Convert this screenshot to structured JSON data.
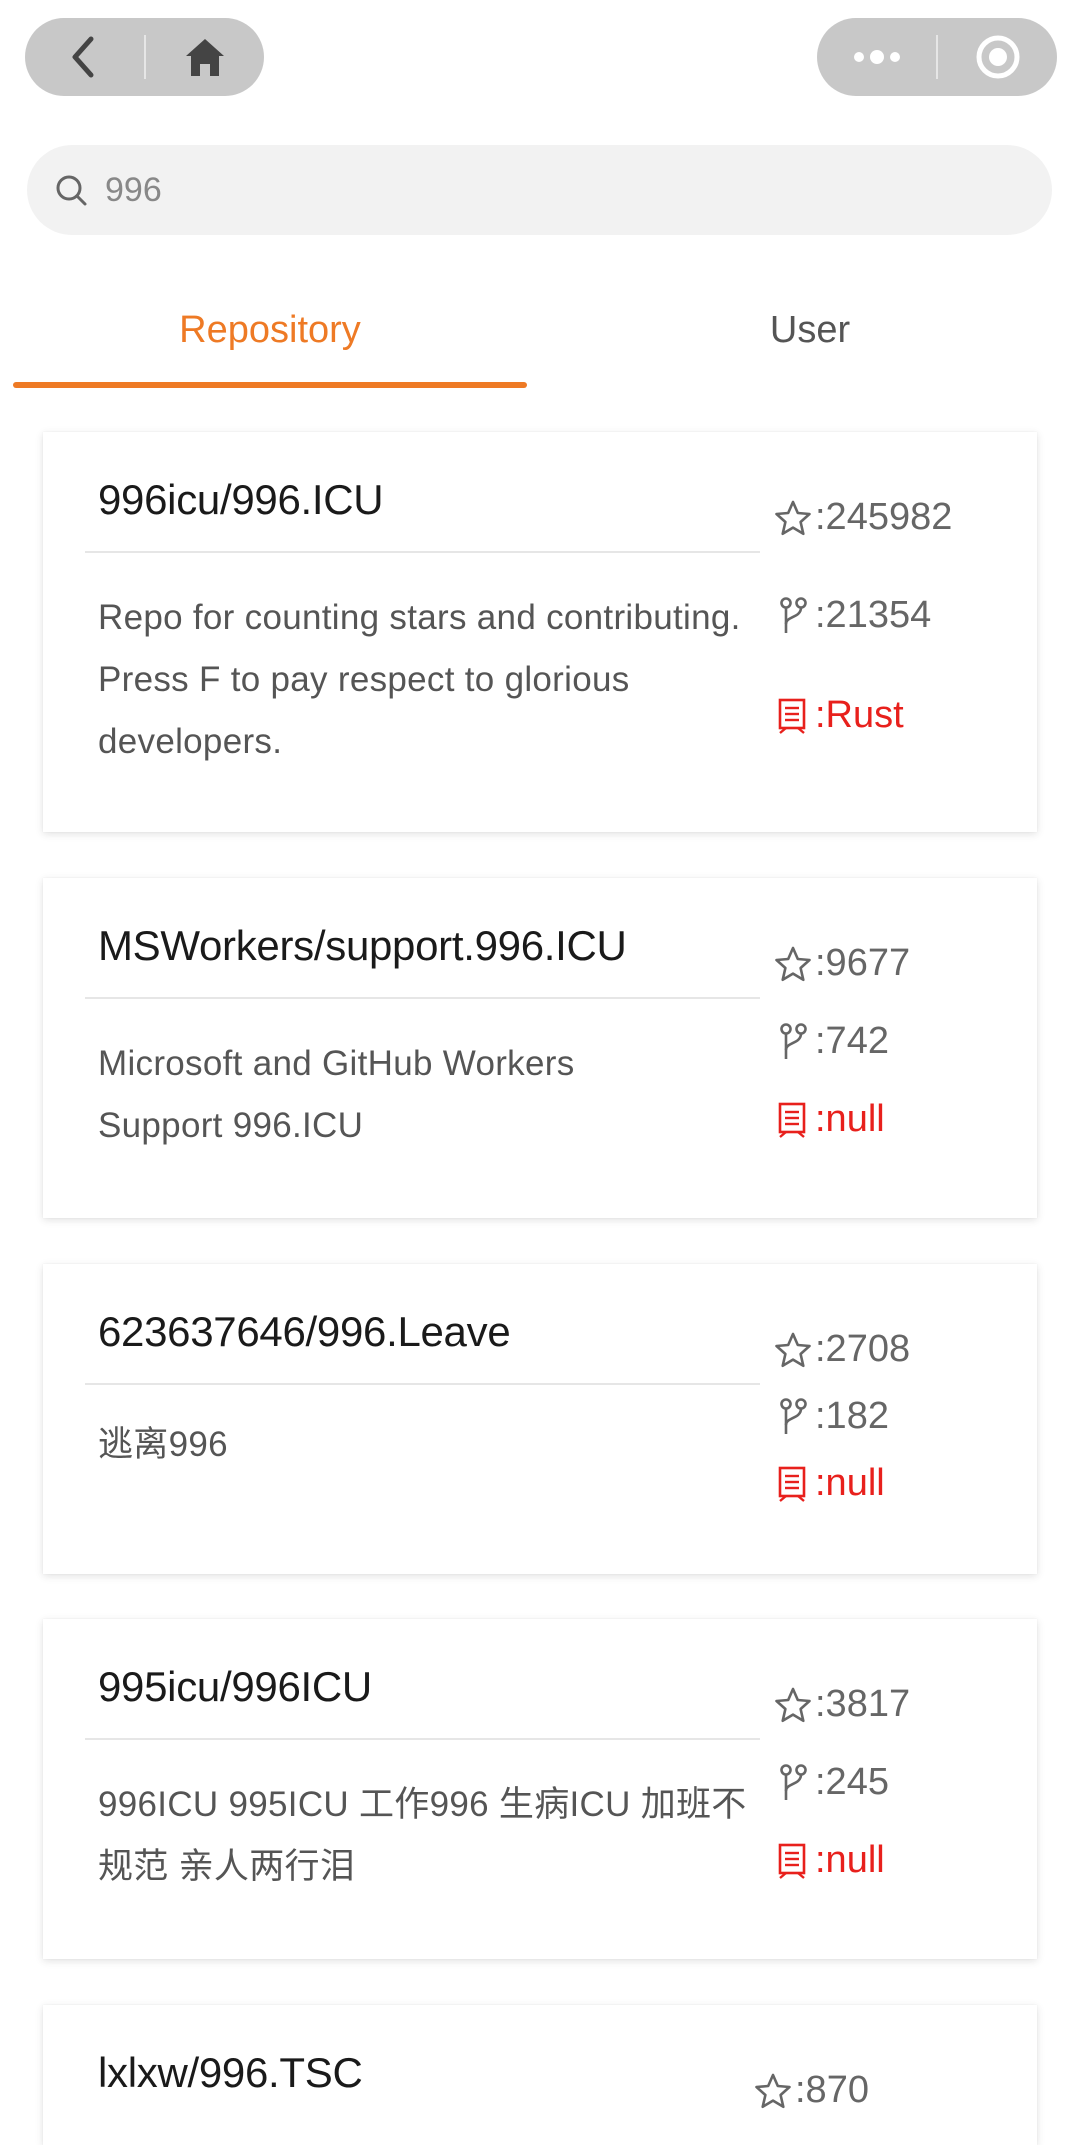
{
  "nav": {
    "left_icons": [
      "chevron-left-icon",
      "home-icon"
    ],
    "right_icons": [
      "more-dots-icon",
      "record-target-icon"
    ]
  },
  "search": {
    "value": "996",
    "icon": "search-icon"
  },
  "tabs": [
    {
      "label": "Repository",
      "active": true
    },
    {
      "label": "User",
      "active": false
    }
  ],
  "colors": {
    "accent": "#ee7a25",
    "language": "#e8201c",
    "capsule": "#c8c8c8"
  },
  "repos": [
    {
      "name": "996icu/996.ICU",
      "description": "Repo for counting stars and contributing. Press F to pay respect to glorious developers.",
      "stars": ":245982",
      "forks": ":21354",
      "language": ":Rust"
    },
    {
      "name": "MSWorkers/support.996.ICU",
      "description": "Microsoft and GitHub Workers Support 996.ICU",
      "stars": ":9677",
      "forks": ":742",
      "language": ":null"
    },
    {
      "name": "623637646/996.Leave",
      "description": "逃离996",
      "stars": ":2708",
      "forks": ":182",
      "language": ":null"
    },
    {
      "name": "995icu/996ICU",
      "description": "996ICU 995ICU 工作996 生病ICU 加班不规范 亲人两行泪",
      "stars": ":3817",
      "forks": ":245",
      "language": ":null"
    },
    {
      "name": "lxlxw/996.TSC",
      "description": "",
      "stars": ":870",
      "forks": "",
      "language": ""
    }
  ]
}
